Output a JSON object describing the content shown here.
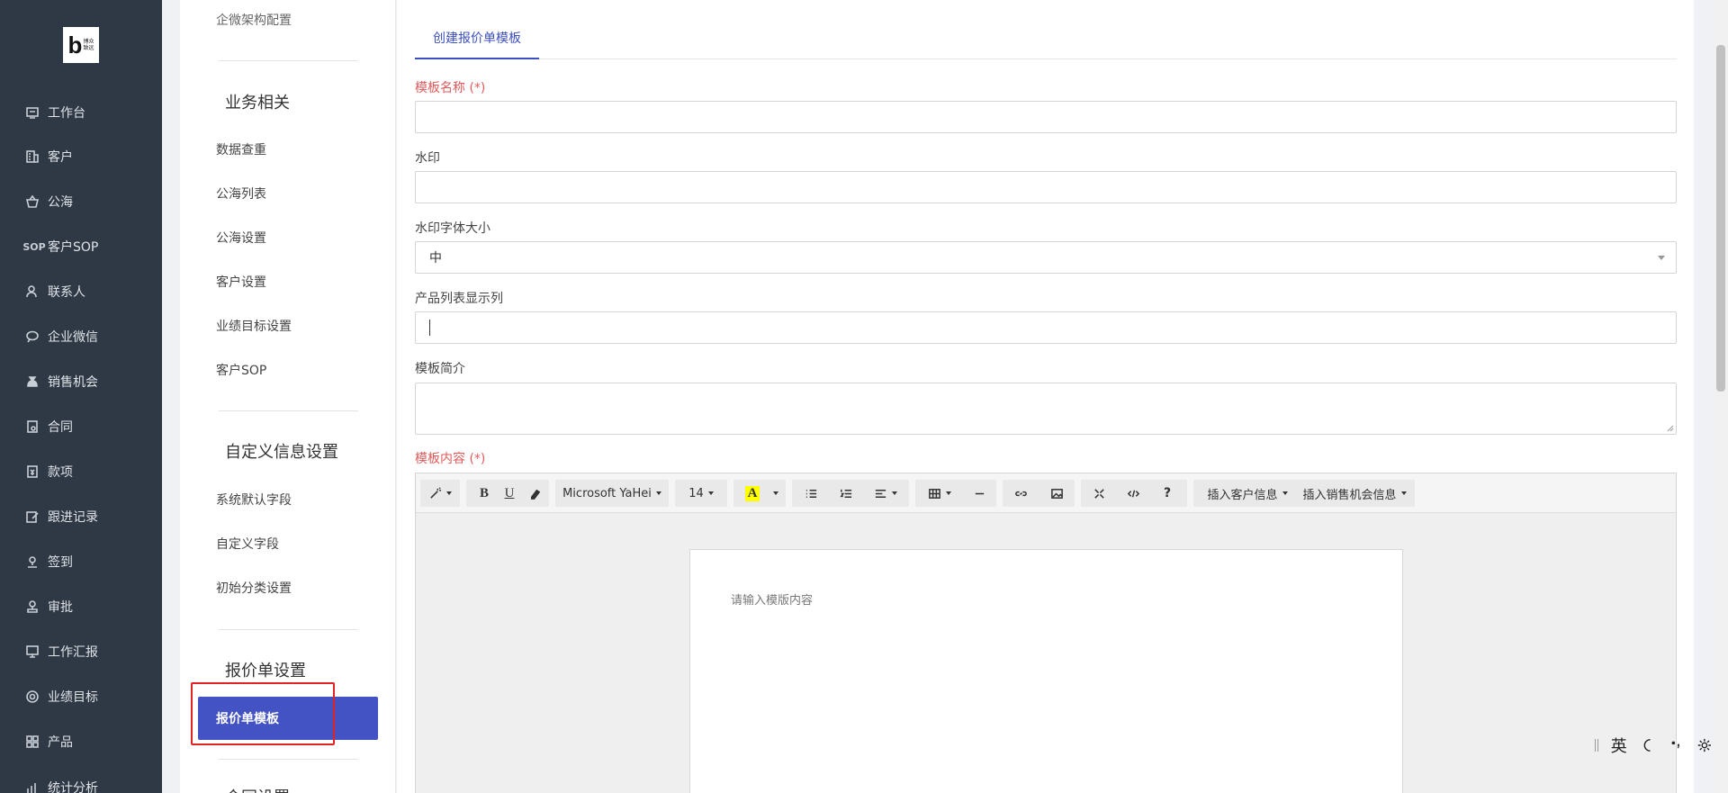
{
  "logo": {
    "mark": "b",
    "text_line1": "博众",
    "text_line2": "致远"
  },
  "nav": {
    "items": [
      {
        "label": "工作台",
        "icon": "monitor-icon"
      },
      {
        "label": "客户",
        "icon": "building-icon"
      },
      {
        "label": "公海",
        "icon": "basket-icon"
      },
      {
        "label": "客户SOP",
        "icon": "sop-icon"
      },
      {
        "label": "联系人",
        "icon": "person-icon"
      },
      {
        "label": "企业微信",
        "icon": "chat-icon"
      },
      {
        "label": "销售机会",
        "icon": "moneybag-icon"
      },
      {
        "label": "合同",
        "icon": "contract-icon"
      },
      {
        "label": "款项",
        "icon": "payment-icon"
      },
      {
        "label": "跟进记录",
        "icon": "edit-icon"
      },
      {
        "label": "签到",
        "icon": "location-icon"
      },
      {
        "label": "审批",
        "icon": "stamp-icon"
      },
      {
        "label": "工作汇报",
        "icon": "report-icon"
      },
      {
        "label": "业绩目标",
        "icon": "target-icon"
      },
      {
        "label": "产品",
        "icon": "grid-icon"
      },
      {
        "label": "统计分析",
        "icon": "chart-icon"
      }
    ]
  },
  "settings": {
    "top_partial": "企微架构配置",
    "groups": [
      {
        "title": "业务相关",
        "links": [
          "数据查重",
          "公海列表",
          "公海设置",
          "客户设置",
          "业绩目标设置",
          "客户SOP"
        ]
      },
      {
        "title": "自定义信息设置",
        "links": [
          "系统默认字段",
          "自定义字段",
          "初始分类设置"
        ]
      },
      {
        "title": "报价单设置",
        "links": [
          "报价单模板"
        ]
      }
    ],
    "active_link": "报价单模板",
    "bottom_partial": "合同设置"
  },
  "form": {
    "tab": "创建报价单模板",
    "name_label": "模板名称 (*)",
    "watermark_label": "水印",
    "watermark_size_label": "水印字体大小",
    "watermark_size_value": "中",
    "product_columns_label": "产品列表显示列",
    "intro_label": "模板简介",
    "content_label": "模板内容 (*)"
  },
  "editor": {
    "font_family": "Microsoft YaHei",
    "font_size": "14",
    "insert_customer": "插入客户信息",
    "insert_opportunity": "插入销售机会信息",
    "placeholder": "请输入模版内容"
  },
  "ime": {
    "lang": "英"
  }
}
